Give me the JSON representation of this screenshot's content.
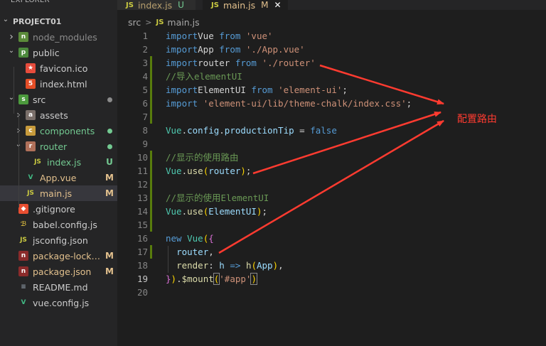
{
  "sidebar": {
    "title": "EXPLORER",
    "items": [
      {
        "label": "PROJECT01",
        "chevron": "open",
        "icon": "none",
        "depth": 0,
        "bold": true
      },
      {
        "label": "node_modules",
        "chevron": "closed",
        "icon": "folder-node-icon",
        "depth": 1,
        "color": "#8b8b8b"
      },
      {
        "label": "public",
        "chevron": "open",
        "icon": "folder-public-icon",
        "depth": 1
      },
      {
        "label": "favicon.ico",
        "chevron": "none",
        "icon": "favicon-file-icon",
        "depth": 2
      },
      {
        "label": "index.html",
        "chevron": "none",
        "icon": "html-file-icon",
        "depth": 2
      },
      {
        "label": "src",
        "chevron": "open",
        "icon": "folder-src-icon",
        "depth": 1,
        "dot": "#8b8b8b"
      },
      {
        "label": "assets",
        "chevron": "closed",
        "icon": "folder-assets-icon",
        "depth": 2
      },
      {
        "label": "components",
        "chevron": "closed",
        "icon": "folder-components-icon",
        "depth": 2,
        "color": "#73c991",
        "dot": "#73c991"
      },
      {
        "label": "router",
        "chevron": "open",
        "icon": "folder-router-icon",
        "depth": 2,
        "color": "#73c991",
        "dot": "#73c991"
      },
      {
        "label": "index.js",
        "chevron": "none",
        "icon": "js-file-icon",
        "depth": 3,
        "color": "#73c991",
        "badge": "U",
        "badge_color": "#73c991"
      },
      {
        "label": "App.vue",
        "chevron": "none",
        "icon": "vue-file-icon",
        "depth": 2,
        "color": "#e2c08d",
        "badge": "M",
        "badge_color": "#e2c08d"
      },
      {
        "label": "main.js",
        "chevron": "none",
        "icon": "js-file-icon",
        "depth": 2,
        "color": "#e2c08d",
        "badge": "M",
        "badge_color": "#e2c08d",
        "selected": true
      },
      {
        "label": ".gitignore",
        "chevron": "none",
        "icon": "git-file-icon",
        "depth": 1
      },
      {
        "label": "babel.config.js",
        "chevron": "none",
        "icon": "babel-file-icon",
        "depth": 1
      },
      {
        "label": "jsconfig.json",
        "chevron": "none",
        "icon": "json-file-icon",
        "depth": 1
      },
      {
        "label": "package-lock.json",
        "chevron": "none",
        "icon": "npm-file-icon",
        "depth": 1,
        "color": "#e2c08d",
        "badge": "M",
        "badge_color": "#e2c08d"
      },
      {
        "label": "package.json",
        "chevron": "none",
        "icon": "npm-file-icon",
        "depth": 1,
        "color": "#e2c08d",
        "badge": "M",
        "badge_color": "#e2c08d"
      },
      {
        "label": "README.md",
        "chevron": "none",
        "icon": "readme-file-icon",
        "depth": 1
      },
      {
        "label": "vue.config.js",
        "chevron": "none",
        "icon": "vue-config-file-icon",
        "depth": 1
      }
    ]
  },
  "tabs": [
    {
      "name": "index.js",
      "status": "U",
      "active": false
    },
    {
      "name": "main.js",
      "status": "M",
      "active": true,
      "close": "✕"
    }
  ],
  "breadcrumb": {
    "folder": "src",
    "separator": ">",
    "file": "main.js",
    "file_icon": "JS"
  },
  "editor": {
    "current_line": 19,
    "modified_lines": [
      3,
      4,
      5,
      6,
      7,
      10,
      11,
      12,
      13,
      14,
      15,
      17
    ],
    "lines": [
      [
        [
          "kw",
          "import"
        ],
        [
          "",
          "Vue "
        ],
        [
          "kw",
          "from"
        ],
        [
          "",
          " "
        ],
        [
          "str",
          "'vue'"
        ]
      ],
      [
        [
          "kw",
          "import"
        ],
        [
          "",
          "App "
        ],
        [
          "kw",
          "from"
        ],
        [
          "",
          " "
        ],
        [
          "str",
          "'./App.vue'"
        ]
      ],
      [
        [
          "kw",
          "import"
        ],
        [
          "",
          "router "
        ],
        [
          "kw",
          "from"
        ],
        [
          "",
          " "
        ],
        [
          "str",
          "'./router'"
        ]
      ],
      [
        [
          "cm",
          "//导入elementUI"
        ]
      ],
      [
        [
          "kw",
          "import"
        ],
        [
          "",
          "ElementUI "
        ],
        [
          "kw",
          "from"
        ],
        [
          "",
          " "
        ],
        [
          "str",
          "'element-ui'"
        ],
        [
          "",
          ";"
        ]
      ],
      [
        [
          "kw",
          "import"
        ],
        [
          "",
          " "
        ],
        [
          "str",
          "'element-ui/lib/theme-chalk/index.css'"
        ],
        [
          "",
          ";"
        ]
      ],
      [],
      [
        [
          "cls",
          "Vue"
        ],
        [
          "",
          "."
        ],
        [
          "prop",
          "config"
        ],
        [
          "",
          "."
        ],
        [
          "prop",
          "productionTip"
        ],
        [
          "",
          " = "
        ],
        [
          "kw",
          "false"
        ]
      ],
      [],
      [
        [
          "cm",
          "//显示的使用路由"
        ]
      ],
      [
        [
          "cls",
          "Vue"
        ],
        [
          "",
          "."
        ],
        [
          "fn",
          "use"
        ],
        [
          "br1",
          "("
        ],
        [
          "prop",
          "router"
        ],
        [
          "br1",
          ")"
        ],
        [
          "",
          ";"
        ]
      ],
      [],
      [
        [
          "cm",
          "//显示的使用ElementUI"
        ]
      ],
      [
        [
          "cls",
          "Vue"
        ],
        [
          "",
          "."
        ],
        [
          "fn",
          "use"
        ],
        [
          "br1",
          "("
        ],
        [
          "prop",
          "ElementUI"
        ],
        [
          "br1",
          ")"
        ],
        [
          "",
          ";"
        ]
      ],
      [],
      [
        [
          "kw",
          "new"
        ],
        [
          "",
          " "
        ],
        [
          "cls",
          "Vue"
        ],
        [
          "br1",
          "("
        ],
        [
          "br2",
          "{"
        ]
      ],
      [
        [
          "",
          "  "
        ],
        [
          "prop",
          "router"
        ],
        [
          "",
          ","
        ]
      ],
      [
        [
          "",
          "  "
        ],
        [
          "fn",
          "render"
        ],
        [
          "",
          ": "
        ],
        [
          "prop",
          "h"
        ],
        [
          "",
          " "
        ],
        [
          "kw",
          "=>"
        ],
        [
          "",
          " "
        ],
        [
          "fn",
          "h"
        ],
        [
          "br1",
          "("
        ],
        [
          "prop",
          "App"
        ],
        [
          "br1",
          ")"
        ],
        [
          "",
          ","
        ]
      ],
      [
        [
          "br2",
          "}"
        ],
        [
          "br1",
          ")"
        ],
        [
          "",
          "."
        ],
        [
          "fn",
          "$mount"
        ],
        [
          "br1b",
          "("
        ],
        [
          "str",
          "'#app'"
        ],
        [
          "br1b",
          ")"
        ]
      ],
      []
    ]
  },
  "annotation": {
    "text": "配置路由",
    "color": "#ff3b30"
  },
  "colors": {
    "accent_modified": "#587c0c",
    "untracked": "#73c991",
    "modified": "#e2c08d"
  }
}
